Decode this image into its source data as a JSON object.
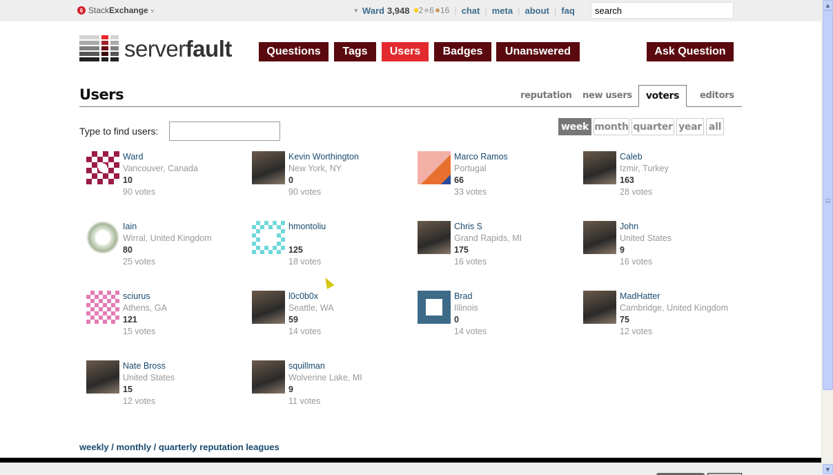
{
  "topbar": {
    "network_badge": "6",
    "network_name_prefix": "Stack",
    "network_name_suffix": "Exchange",
    "network_caret": "v",
    "user_caret": "▼",
    "username": "Ward",
    "reputation": "3,948",
    "badges": [
      {
        "type": "gold",
        "color": "#ffcc00",
        "count": "2"
      },
      {
        "type": "silver",
        "color": "#c0c0c0",
        "count": "6"
      },
      {
        "type": "bronze",
        "color": "#cc9966",
        "count": "16"
      }
    ],
    "links": [
      "chat",
      "meta",
      "about",
      "faq"
    ],
    "search_value": "search"
  },
  "header": {
    "logo_light": "server",
    "logo_bold": "fault",
    "nav": [
      {
        "label": "Questions",
        "active": false
      },
      {
        "label": "Tags",
        "active": false
      },
      {
        "label": "Users",
        "active": true
      },
      {
        "label": "Badges",
        "active": false
      },
      {
        "label": "Unanswered",
        "active": false
      }
    ],
    "ask_button": "Ask Question",
    "colors": {
      "nav": "#5a0a0f",
      "nav_active": "#e32b2f"
    }
  },
  "page": {
    "title": "Users",
    "tabs": [
      {
        "label": "reputation",
        "active": false
      },
      {
        "label": "new users",
        "active": false
      },
      {
        "label": "voters",
        "active": true
      },
      {
        "label": "editors",
        "active": false
      }
    ],
    "find_label": "Type to find users:",
    "find_value": "",
    "filters": [
      {
        "label": "week",
        "active": true
      },
      {
        "label": "month",
        "active": false
      },
      {
        "label": "quarter",
        "active": false
      },
      {
        "label": "year",
        "active": false
      },
      {
        "label": "all",
        "active": false
      }
    ]
  },
  "users": [
    {
      "name": "Ward",
      "location": "Vancouver, Canada",
      "reputation": "10",
      "votes": "90 votes",
      "avatar": "identicon-maroon"
    },
    {
      "name": "Kevin Worthington",
      "location": "New York, NY",
      "reputation": "0",
      "votes": "90 votes",
      "avatar": "photo"
    },
    {
      "name": "Marco Ramos",
      "location": "Portugal",
      "reputation": "66",
      "votes": "33 votes",
      "avatar": "cartoon"
    },
    {
      "name": "Caleb",
      "location": "Izmir, Turkey",
      "reputation": "163",
      "votes": "28 votes",
      "avatar": "photo"
    },
    {
      "name": "Iain",
      "location": "Wirral, United Kingdom",
      "reputation": "80",
      "votes": "25 votes",
      "avatar": "star-graphic"
    },
    {
      "name": "hmontoliu",
      "location": "",
      "reputation": "125",
      "votes": "18 votes",
      "avatar": "identicon-cyan"
    },
    {
      "name": "Chris S",
      "location": "Grand Rapids, MI",
      "reputation": "175",
      "votes": "16 votes",
      "avatar": "photo"
    },
    {
      "name": "John",
      "location": "United States",
      "reputation": "9",
      "votes": "16 votes",
      "avatar": "photo"
    },
    {
      "name": "sciurus",
      "location": "Athens, GA",
      "reputation": "121",
      "votes": "15 votes",
      "avatar": "identicon-pink"
    },
    {
      "name": "l0c0b0x",
      "location": "Seattle, WA",
      "reputation": "59",
      "votes": "14 votes",
      "avatar": "photo"
    },
    {
      "name": "Brad",
      "location": "Illinois",
      "reputation": "0",
      "votes": "14 votes",
      "avatar": "identicon-teal"
    },
    {
      "name": "MadHatter",
      "location": "Cambridge, United Kingdom",
      "reputation": "75",
      "votes": "12 votes",
      "avatar": "photo"
    },
    {
      "name": "Nate Bross",
      "location": "United States",
      "reputation": "15",
      "votes": "12 votes",
      "avatar": "photo"
    },
    {
      "name": "squillman",
      "location": "Wolverine Lake, MI",
      "reputation": "9",
      "votes": "11 votes",
      "avatar": "photo"
    }
  ],
  "footer": {
    "leagues": [
      "weekly",
      "monthly",
      "quarterly reputation leagues"
    ],
    "separator": " / "
  }
}
